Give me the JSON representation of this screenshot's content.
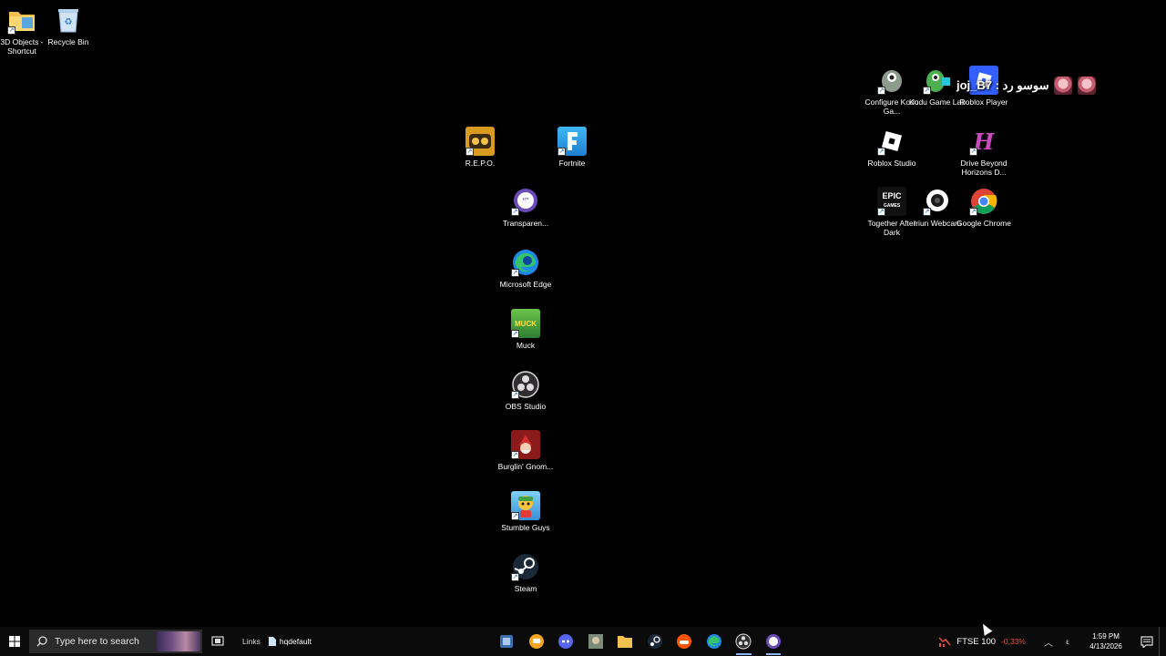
{
  "desktop_icons": [
    {
      "id": "3d-objects",
      "label": "3D Objects - Shortcut",
      "icon": "folder-icon",
      "color": "#f2c14e"
    },
    {
      "id": "recycle-bin",
      "label": "Recycle Bin",
      "icon": "recycle-bin-icon",
      "color": "#9ec9f0"
    },
    {
      "id": "repo",
      "label": "R.E.P.O.",
      "icon": "repo-game-icon",
      "color": "#d99a22"
    },
    {
      "id": "fortnite",
      "label": "Fortnite",
      "icon": "fortnite-icon",
      "color": "#2fa6e8"
    },
    {
      "id": "transparent",
      "label": "Transparen...",
      "icon": "chat-bubble-icon",
      "color": "#6b4bb8"
    },
    {
      "id": "edge",
      "label": "Microsoft Edge",
      "icon": "edge-icon",
      "color": "#1e88e5"
    },
    {
      "id": "muck",
      "label": "Muck",
      "icon": "muck-icon",
      "color": "#3c9a2f"
    },
    {
      "id": "obs",
      "label": "OBS Studio",
      "icon": "obs-icon",
      "color": "#303030"
    },
    {
      "id": "burglin",
      "label": "Burglin' Gnom...",
      "icon": "gnome-icon",
      "color": "#8b1a1a"
    },
    {
      "id": "stumble",
      "label": "Stumble Guys",
      "icon": "stumble-guys-icon",
      "color": "#4fb3e8"
    },
    {
      "id": "steam",
      "label": "Steam",
      "icon": "steam-icon",
      "color": "#1b2838"
    },
    {
      "id": "kodu-config",
      "label": "Configure Kodu Ga...",
      "icon": "kodu-config-icon",
      "color": "#7a8a7a"
    },
    {
      "id": "kodu-lab",
      "label": "Kodu Game Lab",
      "icon": "kodu-icon",
      "color": "#4caf50"
    },
    {
      "id": "roblox-player",
      "label": "Roblox Player",
      "icon": "roblox-player-icon",
      "color": "#335fff"
    },
    {
      "id": "roblox-studio",
      "label": "Roblox Studio",
      "icon": "roblox-studio-icon",
      "color": "#222222"
    },
    {
      "id": "drive-beyond",
      "label": "Drive Beyond Horizons D...",
      "icon": "drive-beyond-icon",
      "color": "#b03aa8"
    },
    {
      "id": "together",
      "label": "Together After Dark",
      "icon": "epic-games-icon",
      "color": "#111111"
    },
    {
      "id": "iriun",
      "label": "Iriun Webcam",
      "icon": "webcam-icon",
      "color": "#ffffff"
    },
    {
      "id": "chrome",
      "label": "Google Chrome",
      "icon": "chrome-icon",
      "color": "#db4437"
    }
  ],
  "overlay": {
    "name": "joj_B7 : سوسو رد"
  },
  "taskbar": {
    "search_placeholder": "Type here to search",
    "links_label": "Links",
    "hq_label": "hqdefault",
    "apps": [
      {
        "icon": "outlook-icon",
        "running": false
      },
      {
        "icon": "chat-icon",
        "running": false
      },
      {
        "icon": "discord-icon",
        "running": false
      },
      {
        "icon": "app-thumb-icon",
        "running": false
      },
      {
        "icon": "file-explorer-icon",
        "running": false
      },
      {
        "icon": "steam-icon",
        "running": false
      },
      {
        "icon": "soundcloud-icon",
        "running": false
      },
      {
        "icon": "edge-icon",
        "running": false
      },
      {
        "icon": "obs-icon",
        "running": true
      },
      {
        "icon": "chat-bubble-icon",
        "running": true
      }
    ],
    "stock": {
      "symbol": "FTSE 100",
      "change": "-0,33%"
    },
    "lang": "ε",
    "time": "1:59 PM",
    "date": "4/13/2026"
  },
  "colors": {
    "taskbar": "#0b0b0b",
    "accent": "#8ab4f8",
    "stock_down": "#e74c3c"
  }
}
